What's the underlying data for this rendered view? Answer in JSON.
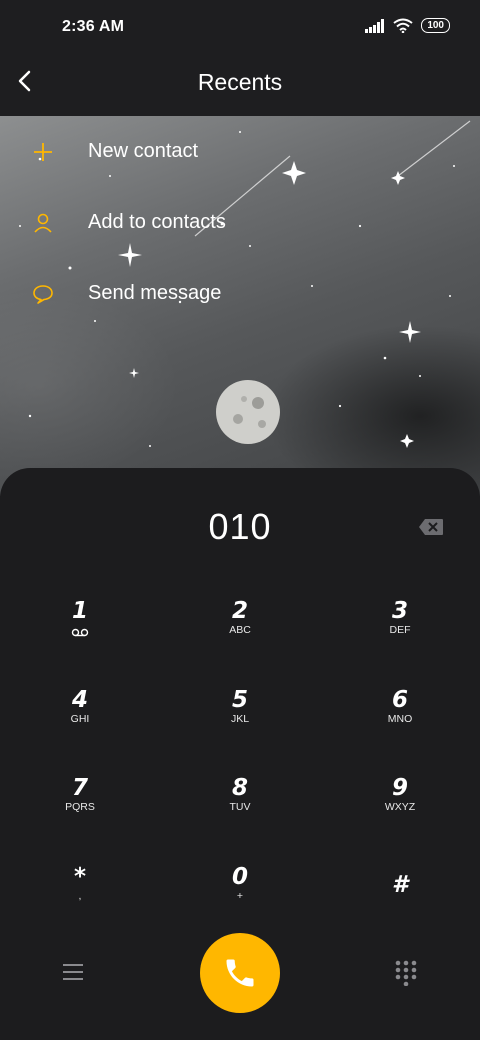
{
  "status_bar": {
    "time": "2:36 AM",
    "battery": "100",
    "icons": [
      "signal-icon",
      "wifi-icon",
      "battery-icon"
    ]
  },
  "header": {
    "title": "Recents",
    "back_icon": "back-arrow-icon"
  },
  "actions": [
    {
      "label": "New contact",
      "icon": "plus-icon"
    },
    {
      "label": "Add to contacts",
      "icon": "person-icon"
    },
    {
      "label": "Send message",
      "icon": "chat-bubble-icon"
    }
  ],
  "dialer": {
    "number": "010",
    "keys": [
      {
        "digit": "1",
        "sub": ""
      },
      {
        "digit": "2",
        "sub": "ABC"
      },
      {
        "digit": "3",
        "sub": "DEF"
      },
      {
        "digit": "4",
        "sub": "GHI"
      },
      {
        "digit": "5",
        "sub": "JKL"
      },
      {
        "digit": "6",
        "sub": "MNO"
      },
      {
        "digit": "7",
        "sub": "PQRS"
      },
      {
        "digit": "8",
        "sub": "TUV"
      },
      {
        "digit": "9",
        "sub": "WXYZ"
      },
      {
        "digit": "*",
        "sub": ","
      },
      {
        "digit": "0",
        "sub": "+"
      },
      {
        "digit": "#",
        "sub": ""
      }
    ]
  },
  "colors": {
    "accent": "#ffb700",
    "background": "#1c1c1e"
  }
}
